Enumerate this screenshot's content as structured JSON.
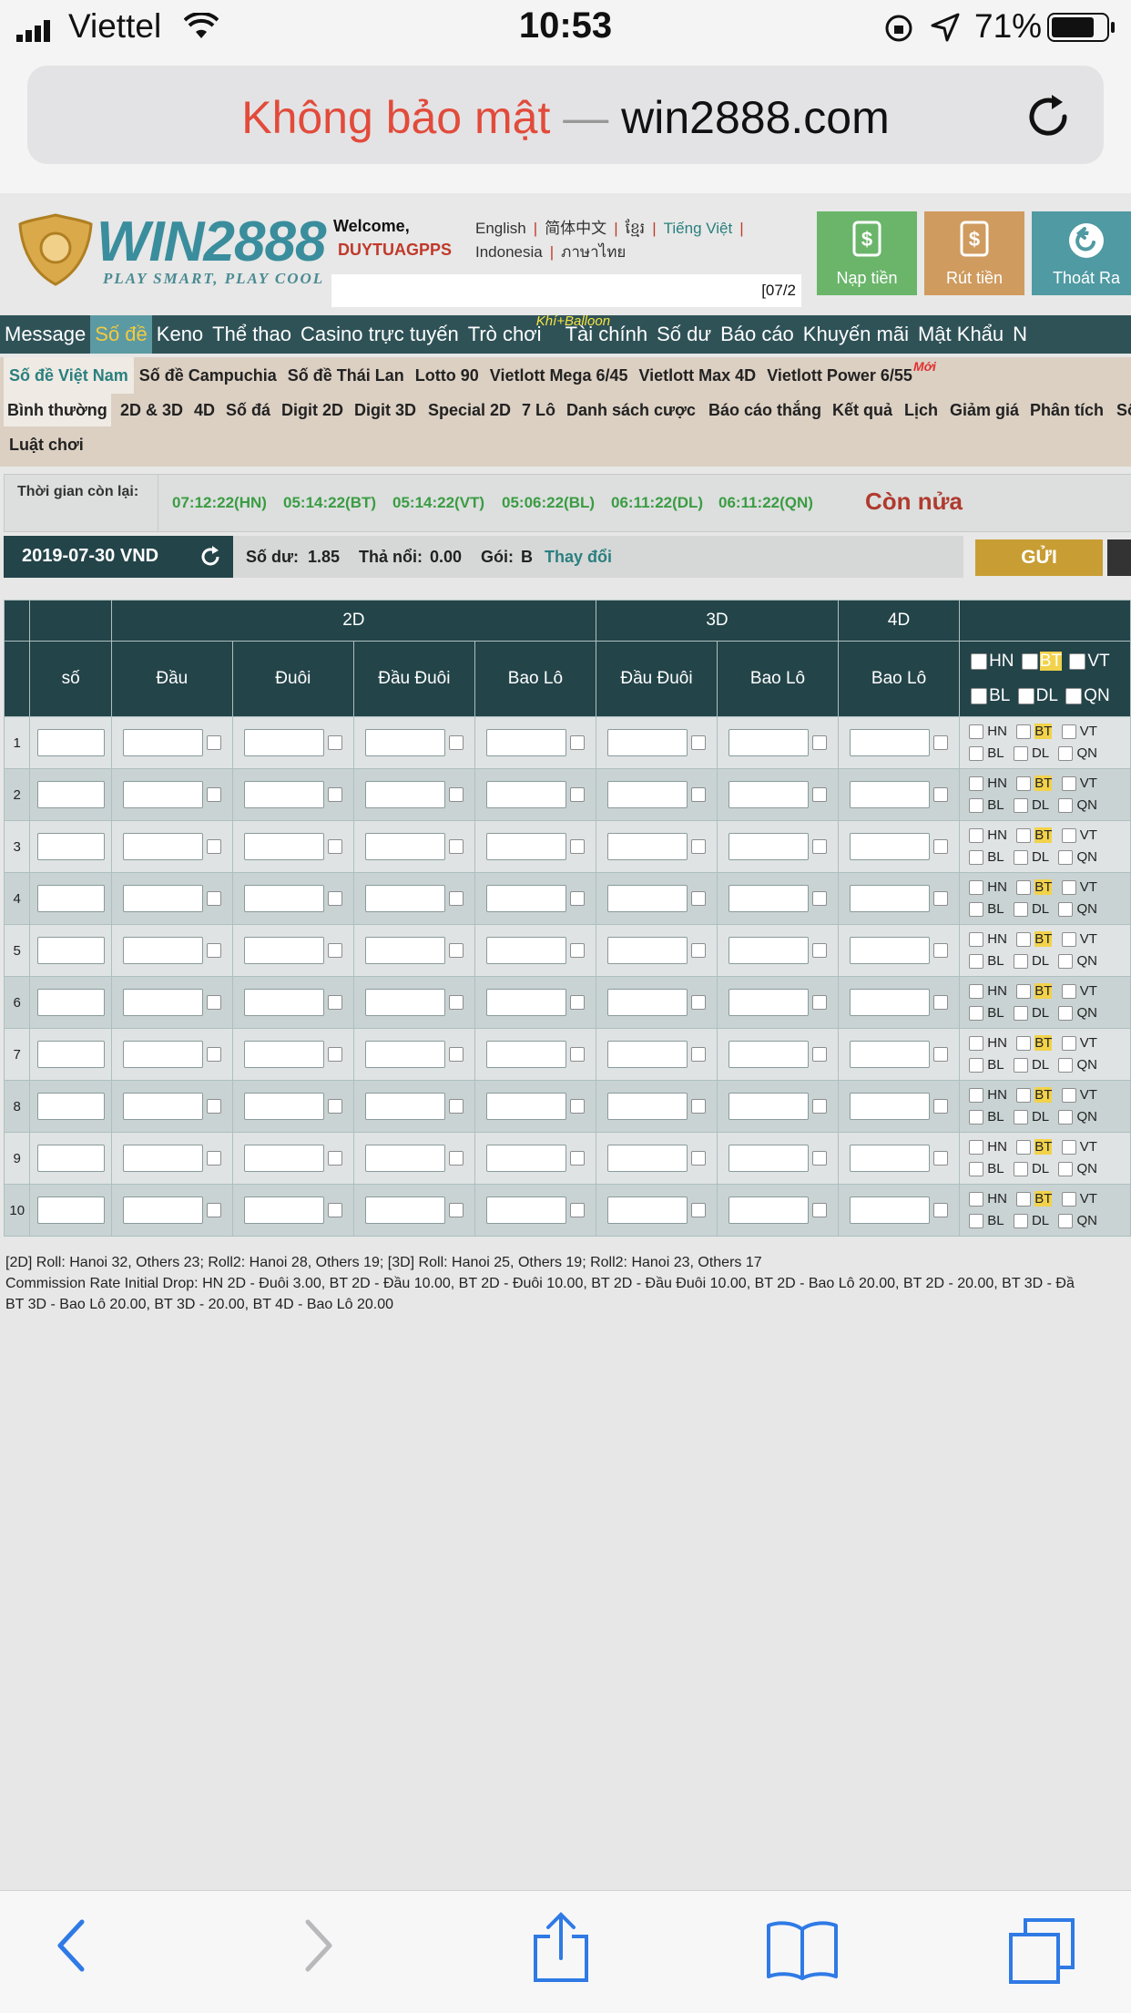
{
  "status": {
    "carrier": "Viettel",
    "time": "10:53",
    "battery": "71%"
  },
  "browser": {
    "insecure_label": "Không bảo mật",
    "dash": " — ",
    "host": "win2888.com"
  },
  "site": {
    "brand": "WIN2888",
    "tagline": "PLAY SMART, PLAY COOL",
    "welcome": "Welcome,",
    "username": "DUYTUAGPPS",
    "languages": [
      "English",
      "简体中文",
      "ខ្មែរ",
      "Tiếng Việt",
      "Indonesia",
      "ภาษาไทย"
    ],
    "ticker": "[07/2",
    "buttons": {
      "deposit": "Nạp tiền",
      "withdraw": "Rút tiền",
      "logout": "Thoát Ra"
    }
  },
  "main_nav": [
    {
      "label": "Message"
    },
    {
      "label": "Số đề",
      "active": true
    },
    {
      "label": "Keno"
    },
    {
      "label": "Thể thao"
    },
    {
      "label": "Casino trực tuyến"
    },
    {
      "label": "Trò chơi",
      "badge": "Khí+Balloon"
    },
    {
      "label": "Tài chính"
    },
    {
      "label": "Số dư"
    },
    {
      "label": "Báo cáo"
    },
    {
      "label": "Khuyến mãi"
    },
    {
      "label": "Mật Khẩu"
    },
    {
      "label": "N"
    }
  ],
  "sub_nav": [
    {
      "label": "Số đề Việt Nam",
      "active": true
    },
    {
      "label": "Số đề Campuchia"
    },
    {
      "label": "Số đề Thái Lan"
    },
    {
      "label": "Lotto 90"
    },
    {
      "label": "Vietlott Mega 6/45"
    },
    {
      "label": "Vietlott Max 4D"
    },
    {
      "label": "Vietlott Power 6/55",
      "badge": "Mới"
    }
  ],
  "sub_nav2": [
    "Bình thường",
    "2D & 3D",
    "4D",
    "Số đá",
    "Digit 2D",
    "Digit 3D",
    "Special 2D",
    "7 Lô",
    "Danh sách cược",
    "Báo cáo thắng",
    "Kết quả",
    "Lịch",
    "Giảm giá",
    "Phân tích",
    "Số",
    "Luật chơi"
  ],
  "countdown": {
    "label": "Thời gian còn lại:",
    "times": [
      "07:12:22(HN)",
      "05:14:22(BT)",
      "05:14:22(VT)",
      "05:06:22(BL)",
      "06:11:22(DL)",
      "06:11:22(QN)"
    ],
    "more": "Còn nửa"
  },
  "balance": {
    "date": "2019-07-30 VND",
    "so_du_label": "Số dư:",
    "so_du": "1.85",
    "tha_noi_label": "Thả nổi:",
    "tha_noi": "0.00",
    "goi_label": "Gói:",
    "goi": "B",
    "change": "Thay đổi",
    "send": "GỬI"
  },
  "table": {
    "group_headers": [
      "2D",
      "3D",
      "4D"
    ],
    "columns": [
      "số",
      "Đầu",
      "Đuôi",
      "Đầu Đuôi",
      "Bao Lô",
      "Đầu Đuôi",
      "Bao Lô",
      "Bao Lô"
    ],
    "provinces_row1": [
      "HN",
      "BT",
      "VT"
    ],
    "provinces_row2": [
      "BL",
      "DL",
      "QN"
    ],
    "rows": [
      "1",
      "2",
      "3",
      "4",
      "5",
      "6",
      "7",
      "8",
      "9",
      "10"
    ]
  },
  "footnote": {
    "line1": "[2D] Roll: Hanoi 32, Others 23; Roll2: Hanoi 28, Others 19; [3D] Roll: Hanoi 25, Others 19; Roll2: Hanoi 23, Others 17",
    "line2": "Commission Rate Initial Drop: HN 2D - Đuôi 3.00, BT 2D - Đầu 10.00, BT 2D - Đuôi 10.00, BT 2D - Đầu Đuôi 10.00, BT 2D - Bao Lô 20.00, BT 2D - 20.00, BT 3D - Đầ",
    "line3": "BT 3D - Bao Lô 20.00, BT 3D - 20.00, BT 4D - Bao Lô 20.00"
  }
}
